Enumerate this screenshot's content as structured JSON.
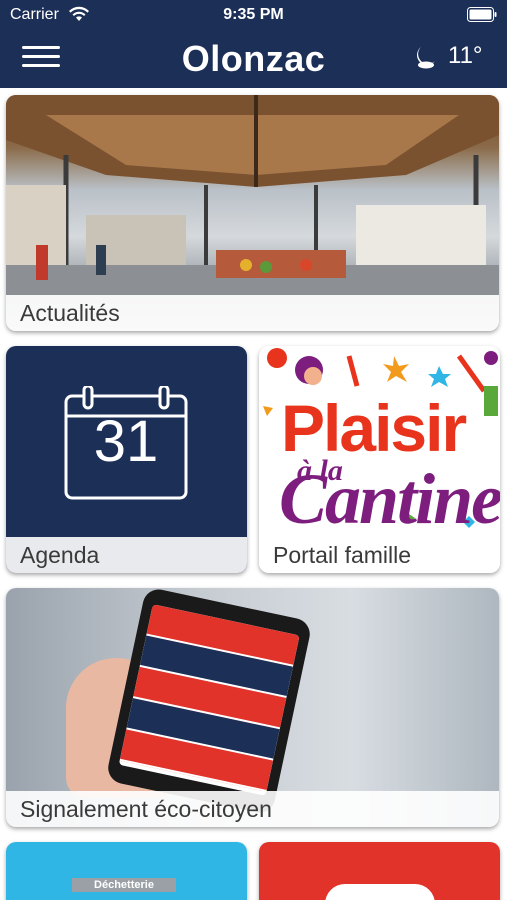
{
  "status_bar": {
    "carrier": "Carrier",
    "time": "9:35 PM",
    "icons": [
      "wifi-icon",
      "battery-icon"
    ]
  },
  "header": {
    "title": "Olonzac",
    "weather_icon": "moon-icon",
    "temperature": "11°",
    "menu_icon": "menu-icon"
  },
  "tiles": [
    {
      "label": "Actualités"
    },
    {
      "label": "Agenda",
      "calendar_day": "31"
    },
    {
      "label": "Portail famille",
      "image_text_1": "Plaisir",
      "image_text_2": "à la",
      "image_text_3": "Cantine"
    },
    {
      "label": "Signalement éco-citoyen"
    },
    {
      "label": "",
      "image_text": "Déchetterie"
    },
    {
      "label": ""
    }
  ],
  "colors": {
    "header_bg": "#1c2f57",
    "agenda_bg": "#1c2f57",
    "dechetterie_bg": "#2fb6e4",
    "red_tile_bg": "#e2332a",
    "cantine_red": "#e8341c",
    "cantine_purple": "#7d1e7e"
  }
}
